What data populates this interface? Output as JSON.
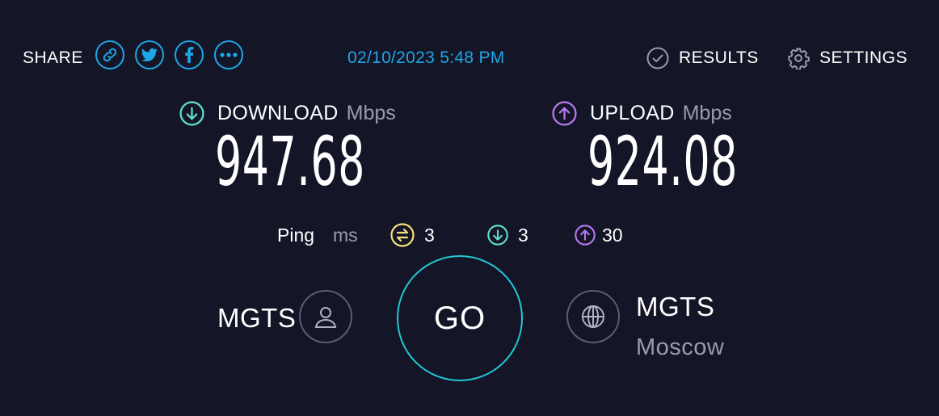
{
  "header": {
    "share_label": "SHARE",
    "share_buttons": [
      {
        "icon": "link-icon"
      },
      {
        "icon": "twitter-icon"
      },
      {
        "icon": "facebook-icon"
      },
      {
        "icon": "more-icon"
      }
    ],
    "timestamp": "02/10/2023 5:48 PM",
    "results_label": "RESULTS",
    "settings_label": "SETTINGS"
  },
  "download": {
    "label": "DOWNLOAD",
    "unit": "Mbps",
    "value": "947.68",
    "color": "#5fe0d0"
  },
  "upload": {
    "label": "UPLOAD",
    "unit": "Mbps",
    "value": "924.08",
    "color": "#b678f0"
  },
  "ping": {
    "label": "Ping",
    "unit": "ms",
    "idle": "3",
    "download": "3",
    "upload": "30",
    "idle_color": "#f5e07a"
  },
  "isp": {
    "name": "MGTS"
  },
  "go_label": "GO",
  "server": {
    "name": "MGTS",
    "location": "Moscow"
  },
  "colors": {
    "background": "#141526",
    "accent_blue": "#1ea7e8",
    "go_ring": "#22c7d6",
    "muted_text": "#9a9cad"
  }
}
